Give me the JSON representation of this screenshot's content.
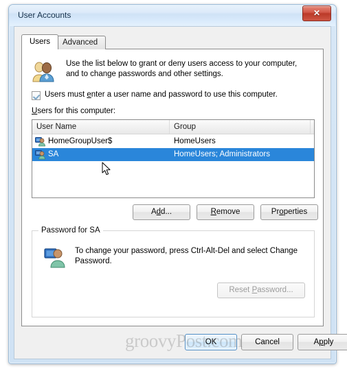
{
  "window": {
    "title": "User Accounts",
    "close_label": "✕"
  },
  "tabs": [
    {
      "label": "Users",
      "active": true
    },
    {
      "label": "Advanced",
      "active": false
    }
  ],
  "info": {
    "icon": "two-users-icon",
    "line1": "Use the list below to grant or deny users access to your computer,",
    "line2": "and to change passwords and other settings."
  },
  "checkbox": {
    "checked": true,
    "label_before": "Users must ",
    "label_accel": "e",
    "label_after": "nter a user name and password to use this computer."
  },
  "list": {
    "label_accel": "U",
    "label_after": "sers for this computer:",
    "columns": [
      "User Name",
      "Group",
      ""
    ],
    "rows": [
      {
        "icon": "user-account-icon",
        "name": "HomeGroupUser$",
        "group": "HomeUsers",
        "selected": false
      },
      {
        "icon": "user-account-icon",
        "name": "SA",
        "group": "HomeUsers; Administrators",
        "selected": true
      }
    ],
    "selection_color": "#2a86da"
  },
  "actions": {
    "add": {
      "before": "A",
      "accel": "d",
      "after": "d..."
    },
    "remove": {
      "before": "",
      "accel": "R",
      "after": "emove"
    },
    "properties": {
      "before": "Pr",
      "accel": "o",
      "after": "perties"
    }
  },
  "password_group": {
    "title": "Password for SA",
    "icon": "user-monitor-icon",
    "text_line1": "To change your password, press Ctrl-Alt-Del and select Change",
    "text_line2": "Password.",
    "reset_button": {
      "before": "Reset ",
      "accel": "P",
      "after": "assword..."
    },
    "reset_enabled": false
  },
  "footer": {
    "ok": "OK",
    "cancel": "Cancel",
    "apply_before": "A",
    "apply_accel": "p",
    "apply_after": "ply"
  },
  "watermark": {
    "text": "groovyPost.com"
  }
}
